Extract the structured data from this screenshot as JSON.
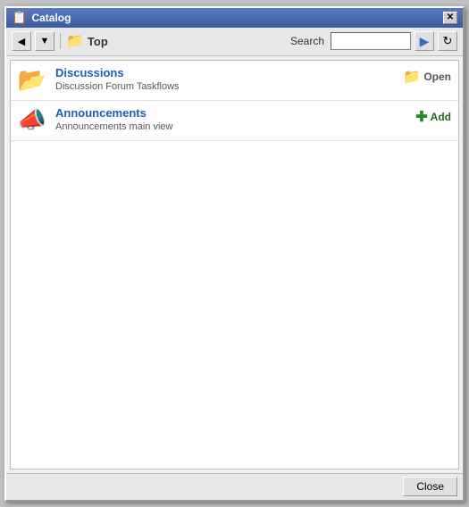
{
  "window": {
    "title": "Catalog",
    "close_label": "✕"
  },
  "toolbar": {
    "back_label": "◀",
    "dropdown_label": "▼",
    "folder_name": "Top",
    "search_label": "Search",
    "search_placeholder": "",
    "go_icon": "▶",
    "refresh_icon": "↻"
  },
  "items": [
    {
      "id": "discussions",
      "title": "Discussions",
      "description": "Discussion Forum Taskflows",
      "action_label": "Open",
      "action_type": "open",
      "icon_type": "open-folder"
    },
    {
      "id": "announcements",
      "title": "Announcements",
      "description": "Announcements main view",
      "action_label": "Add",
      "action_type": "add",
      "icon_type": "megaphone"
    }
  ],
  "footer": {
    "close_label": "Close"
  }
}
